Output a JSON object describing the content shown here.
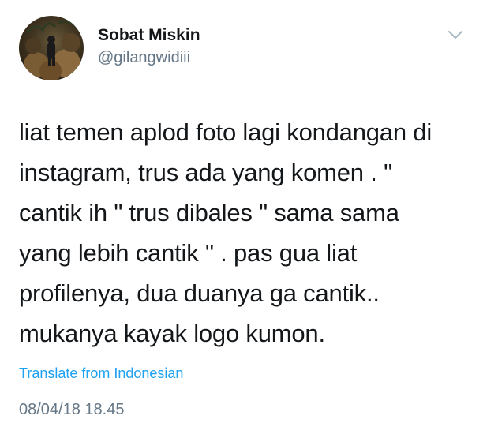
{
  "author": {
    "display_name": "Sobat Miskin",
    "username": "@gilangwidiii",
    "avatar_icon": "profile-photo"
  },
  "tweet": {
    "lines": [
      "liat temen aplod foto lagi kondangan di",
      "instagram, trus ada yang komen . \"",
      "cantik ih \" trus dibales \" sama sama",
      "yang lebih cantik \" . pas gua liat",
      "profilenya, dua duanya ga cantik..",
      "mukanya kayak logo kumon."
    ],
    "translate_label": "Translate from Indonesian",
    "timestamp": "08/04/18 18.45"
  },
  "colors": {
    "text": "#14171a",
    "secondary": "#657786",
    "link": "#1da1f2",
    "chevron": "#aab8c2"
  },
  "icons": {
    "menu": "chevron-down-icon"
  }
}
